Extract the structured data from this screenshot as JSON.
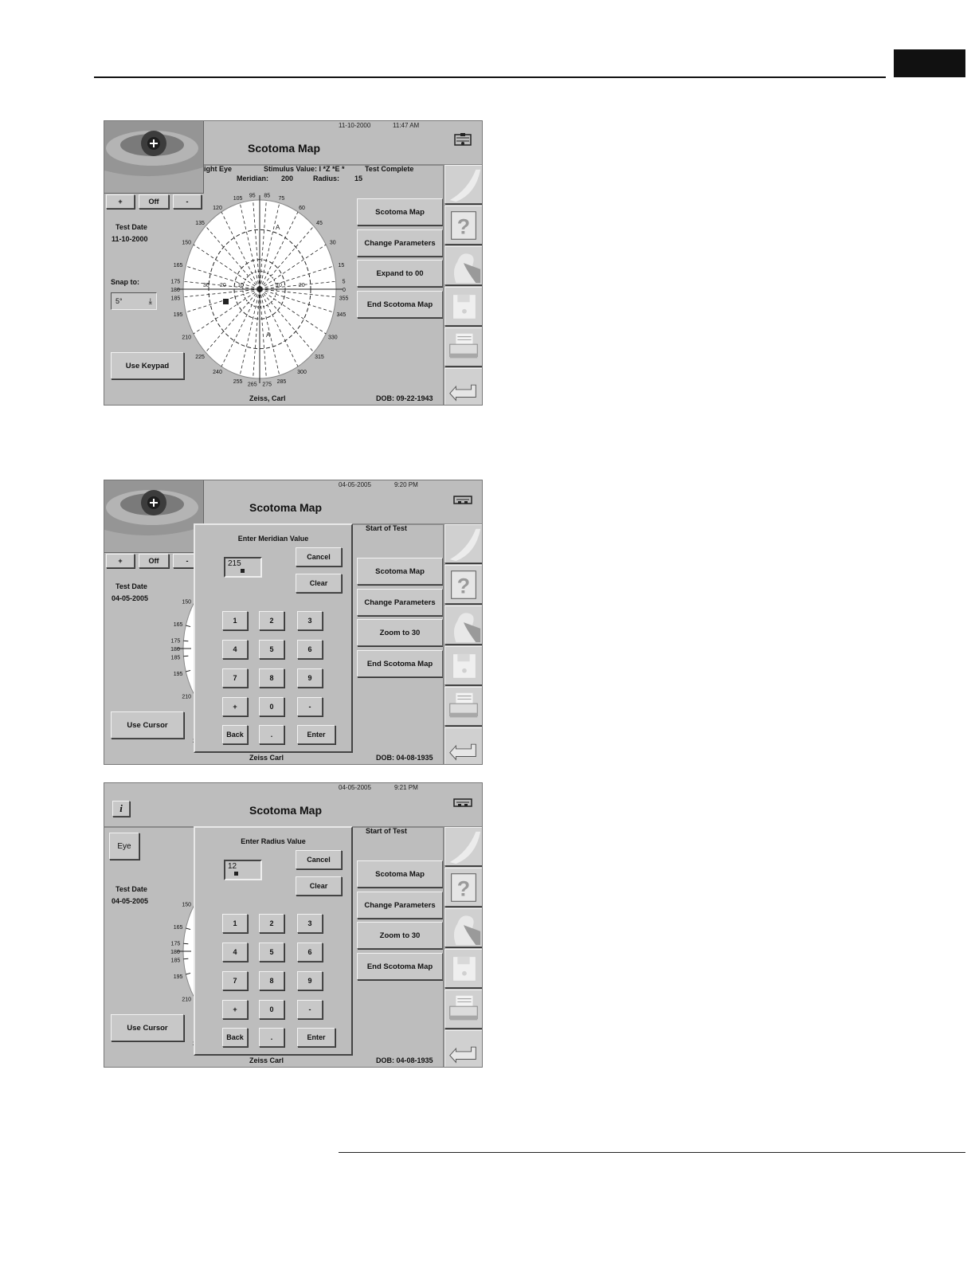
{
  "screens": [
    {
      "date": "11-10-2000",
      "time": "11:47 AM",
      "title": "Scotoma Map",
      "camera_controls": [
        "+",
        "Off",
        "-"
      ],
      "test_date_label": "Test Date",
      "test_date": "11-10-2000",
      "status": {
        "eye": "ight Eye",
        "stimulus": "Stimulus Value: I *Z *E *",
        "state": "Test Complete",
        "meridian_label": "Meridian:",
        "meridian_value": "200",
        "radius_label": "Radius:",
        "radius_value": "15"
      },
      "snap_label": "Snap to:",
      "snap_value": "5°",
      "use_button": "Use Keypad",
      "right_buttons": [
        "Scotoma Map",
        "Change Parameters",
        "Expand to 00",
        "End Scotoma Map"
      ],
      "patient_name": "Zeiss, Carl",
      "dob": "DOB: 09-22-1943",
      "grid": {
        "meridian_labels": [
          "0",
          "15",
          "30",
          "45",
          "60",
          "75",
          "85",
          "95",
          "105",
          "120",
          "135",
          "150",
          "165",
          "175",
          "180",
          "185",
          "195",
          "210",
          "225",
          "240",
          "255",
          "265",
          "275",
          "285",
          "300",
          "315",
          "330",
          "345",
          "355",
          "5"
        ],
        "radius_labels": [
          "30",
          "20",
          "10",
          "10",
          "20"
        ],
        "markers": [
          "A",
          "A"
        ]
      }
    },
    {
      "date": "04-05-2005",
      "time": "9:20 PM",
      "title": "Scotoma Map",
      "camera_controls": [
        "+",
        "Off",
        "-"
      ],
      "test_date_label": "Test Date",
      "test_date": "04-05-2005",
      "status_text": "Start of Test",
      "dialog_title": "Enter Meridian Value",
      "entry_value": "215",
      "cancel_label": "Cancel",
      "clear_label": "Clear",
      "keys": [
        "1",
        "2",
        "3",
        "4",
        "5",
        "6",
        "7",
        "8",
        "9",
        "+",
        "0",
        "-",
        "Back",
        ".",
        "Enter"
      ],
      "use_button": "Use Cursor",
      "right_buttons": [
        "Scotoma Map",
        "Change Parameters",
        "Zoom to 30",
        "End Scotoma Map"
      ],
      "patient_name": "Zeiss Carl",
      "dob": "DOB: 04-08-1935",
      "partial_labels": [
        "150",
        "165",
        "175",
        "180",
        "185",
        "195",
        "210",
        "2"
      ]
    },
    {
      "date": "04-05-2005",
      "time": "9:21 PM",
      "title": "Scotoma Map",
      "info_icon": "i",
      "eye_button": "Eye",
      "test_date_label": "Test Date",
      "test_date": "04-05-2005",
      "status_text": "Start of Test",
      "dialog_title": "Enter Radius Value",
      "entry_value": "12",
      "cancel_label": "Cancel",
      "clear_label": "Clear",
      "keys": [
        "1",
        "2",
        "3",
        "4",
        "5",
        "6",
        "7",
        "8",
        "9",
        "+",
        "0",
        "-",
        "Back",
        ".",
        "Enter"
      ],
      "use_button": "Use Cursor",
      "right_buttons": [
        "Scotoma Map",
        "Change Parameters",
        "Zoom to 30",
        "End Scotoma Map"
      ],
      "patient_name": "Zeiss Carl",
      "dob": "DOB: 04-08-1935",
      "partial_labels": [
        "150",
        "165",
        "175",
        "180",
        "185",
        "195",
        "210",
        "2"
      ]
    }
  ],
  "side_icons": [
    "blank-icon",
    "help-icon",
    "patient-icon",
    "disk-icon",
    "printer-icon",
    "return-icon"
  ]
}
